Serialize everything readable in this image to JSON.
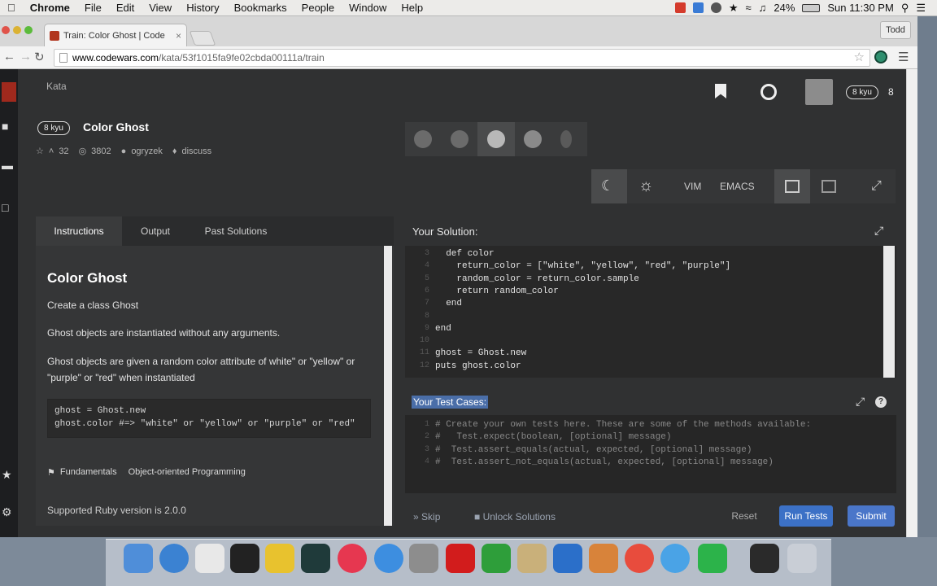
{
  "menubar": {
    "app": "Chrome",
    "items": [
      "File",
      "Edit",
      "View",
      "History",
      "Bookmarks",
      "People",
      "Window",
      "Help"
    ],
    "battery": "24%",
    "clock": "Sun 11:30 PM"
  },
  "browser": {
    "tab_title": "Train: Color Ghost | Code",
    "user": "Todd",
    "url_domain": "www.codewars.com",
    "url_path": "/kata/53f1015fa9fe02cbda00111a/train"
  },
  "kata": {
    "breadcrumb": "Kata",
    "rank": "8 kyu",
    "title": "Color Ghost",
    "votes": "32",
    "completions": "3802",
    "author": "ogryzek",
    "discuss": "discuss",
    "user_rank": "8 kyu",
    "honor": "8"
  },
  "tabs": [
    "Instructions",
    "Output",
    "Past Solutions"
  ],
  "instructions": {
    "heading": "Color Ghost",
    "p1": "Create a class Ghost",
    "p2": "Ghost objects are instantiated without any arguments.",
    "p3": "Ghost objects are given a random color attribute of white\" or \"yellow\" or \"purple\" or \"red\" when instantiated",
    "code_line1": "ghost = Ghost.new",
    "code_line2": "ghost.color  #=> \"white\" or \"yellow\" or \"purple\" or \"red\"",
    "tags": [
      "Fundamentals",
      "Object-oriented Programming"
    ],
    "supported": "Supported Ruby version is 2.0.0"
  },
  "solution": {
    "label": "Your Solution:",
    "lines": [
      {
        "n": "3",
        "text": "  def color"
      },
      {
        "n": "4",
        "text": "    return_color = [\"white\", \"yellow\", \"red\", \"purple\"]"
      },
      {
        "n": "5",
        "text": "    random_color = return_color.sample"
      },
      {
        "n": "6",
        "text": "    return random_color"
      },
      {
        "n": "7",
        "text": "  end"
      },
      {
        "n": "8",
        "text": ""
      },
      {
        "n": "9",
        "text": "end"
      },
      {
        "n": "10",
        "text": ""
      },
      {
        "n": "11",
        "text": "ghost = Ghost.new"
      },
      {
        "n": "12",
        "text": "puts ghost.color"
      }
    ]
  },
  "tests": {
    "label": "Your Test Cases:",
    "lines": [
      {
        "n": "1",
        "text": "# Create your own tests here. These are some of the methods available:"
      },
      {
        "n": "2",
        "text": "#   Test.expect(boolean, [optional] message)"
      },
      {
        "n": "3",
        "text": "#  Test.assert_equals(actual, expected, [optional] message)"
      },
      {
        "n": "4",
        "text": "#  Test.assert_not_equals(actual, expected, [optional] message)"
      }
    ]
  },
  "editor_settings": {
    "vim": "VIM",
    "emacs": "EMACS"
  },
  "actions": {
    "skip": "Skip",
    "unlock": "Unlock Solutions",
    "reset": "Reset",
    "run": "Run Tests",
    "submit": "Submit"
  },
  "colors": {
    "accent_blue": "#4a76c9",
    "run_blue": "#3c71c6",
    "page_bg": "#303132"
  }
}
